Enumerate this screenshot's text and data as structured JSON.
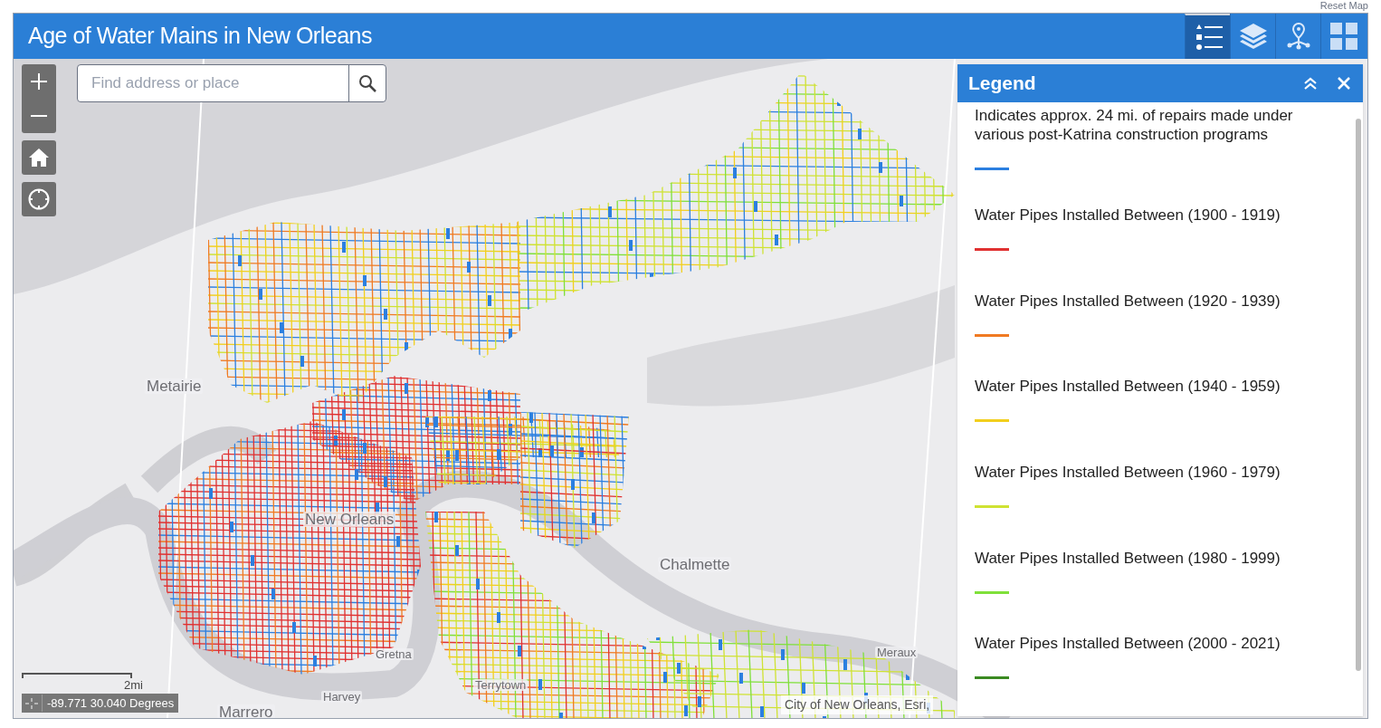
{
  "top_link": "Reset Map",
  "app": {
    "title": "Age of Water Mains in New Orleans",
    "tools": [
      {
        "kind": "legend",
        "selected": true
      },
      {
        "kind": "layers",
        "selected": false
      },
      {
        "kind": "locate",
        "selected": false
      },
      {
        "kind": "grid",
        "selected": false
      }
    ]
  },
  "search": {
    "placeholder": "Find address or place"
  },
  "map": {
    "labels": [
      "Metairie",
      "New Orleans",
      "Chalmette",
      "Gretna",
      "Terrytown",
      "Harvey",
      "Marrero",
      "Meraux"
    ],
    "scale": "2mi",
    "coordinates": "-89.771 30.040 Degrees",
    "attribution": "City of New Orleans, Esri,"
  },
  "legend": {
    "title": "Legend",
    "items": [
      {
        "label": "Indicates approx. 24 mi. of repairs made under various post-Katrina construction programs",
        "color": "#2b7fe0"
      },
      {
        "label": "Water Pipes Installed Between (1900 - 1919)",
        "color": "#e03131"
      },
      {
        "label": "Water Pipes Installed Between (1920 - 1939)",
        "color": "#f07a22"
      },
      {
        "label": "Water Pipes Installed Between (1940 - 1959)",
        "color": "#f2cf1d"
      },
      {
        "label": "Water Pipes Installed Between (1960 - 1979)",
        "color": "#cfe233"
      },
      {
        "label": "Water Pipes Installed Between (1980 - 1999)",
        "color": "#7fe03a"
      },
      {
        "label": "Water Pipes Installed Between (2000 - 2021)",
        "color": "#3b8a22"
      }
    ]
  }
}
